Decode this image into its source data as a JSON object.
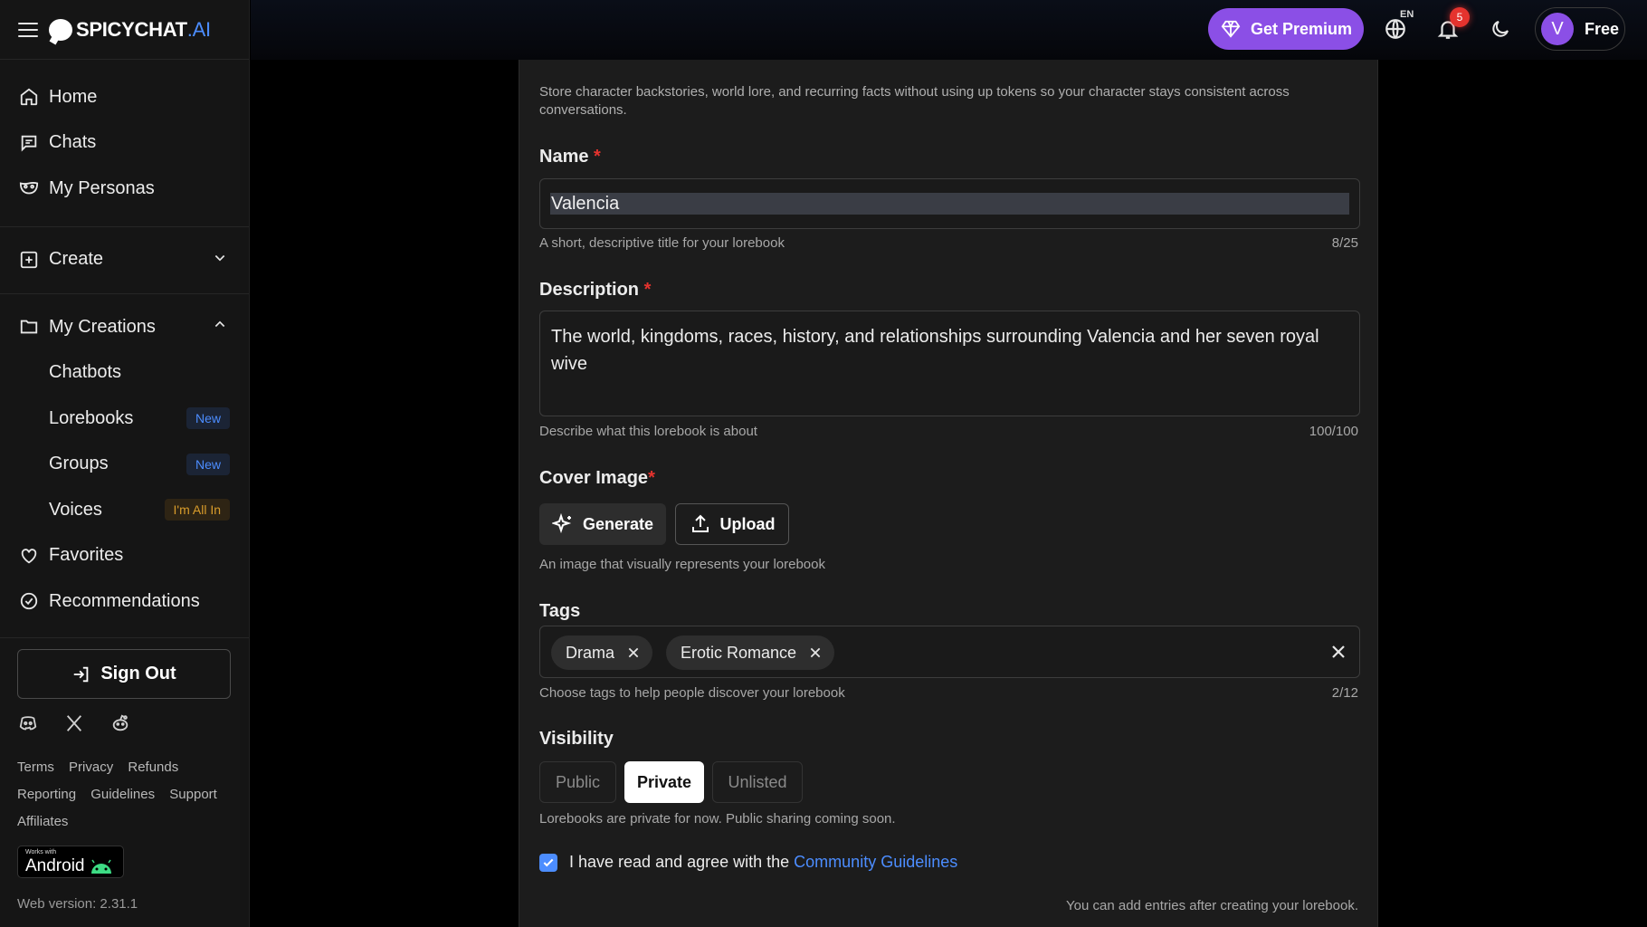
{
  "brand": {
    "name": "SPICYCHAT",
    "suffix": ".AI"
  },
  "sidebar": {
    "primary": [
      {
        "label": "Home",
        "icon": "home-icon"
      },
      {
        "label": "Chats",
        "icon": "chat-icon"
      },
      {
        "label": "My Personas",
        "icon": "mask-icon"
      }
    ],
    "create": {
      "label": "Create",
      "icon": "plus-square-icon"
    },
    "my_creations": {
      "label": "My Creations",
      "items": [
        {
          "label": "Chatbots",
          "badge": ""
        },
        {
          "label": "Lorebooks",
          "badge": "New"
        },
        {
          "label": "Groups",
          "badge": "New"
        },
        {
          "label": "Voices",
          "badge": "I'm All In"
        }
      ]
    },
    "favorites": "Favorites",
    "recommendations": "Recommendations",
    "sign_out": "Sign Out",
    "footer_links": [
      "Terms",
      "Privacy",
      "Refunds",
      "Reporting",
      "Guidelines",
      "Support",
      "Affiliates"
    ],
    "android": {
      "small": "Works with",
      "big": "Android"
    },
    "web_version": "Web version: 2.31.1"
  },
  "topbar": {
    "premium_label": "Get Premium",
    "language": "EN",
    "notification_count": "5",
    "avatar_initial": "V",
    "plan": "Free"
  },
  "form": {
    "intro": "Store character backstories, world lore, and recurring facts without using up tokens so your character stays consistent across conversations.",
    "name": {
      "label": "Name",
      "required": "*",
      "value": "Valencia",
      "hint": "A short, descriptive title for your lorebook",
      "count": "8/25"
    },
    "description": {
      "label": "Description",
      "required": "*",
      "value": "The world, kingdoms, races, history, and relationships surrounding Valencia and her seven royal wive",
      "hint": "Describe what this lorebook is about",
      "count": "100/100"
    },
    "cover": {
      "label": "Cover Image",
      "required": "*",
      "generate_label": "Generate",
      "upload_label": "Upload",
      "hint": "An image that visually represents your lorebook"
    },
    "tags": {
      "label": "Tags",
      "items": [
        "Drama",
        "Erotic Romance"
      ],
      "hint": "Choose tags to help people discover your lorebook",
      "count": "2/12"
    },
    "visibility": {
      "label": "Visibility",
      "options": [
        "Public",
        "Private",
        "Unlisted"
      ],
      "selected": "Private",
      "hint": "Lorebooks are private for now. Public sharing coming soon."
    },
    "agreement": {
      "text": "I have read and agree with the",
      "link": "Community Guidelines",
      "checked": true
    },
    "entries_note": "You can add entries after creating your lorebook."
  }
}
